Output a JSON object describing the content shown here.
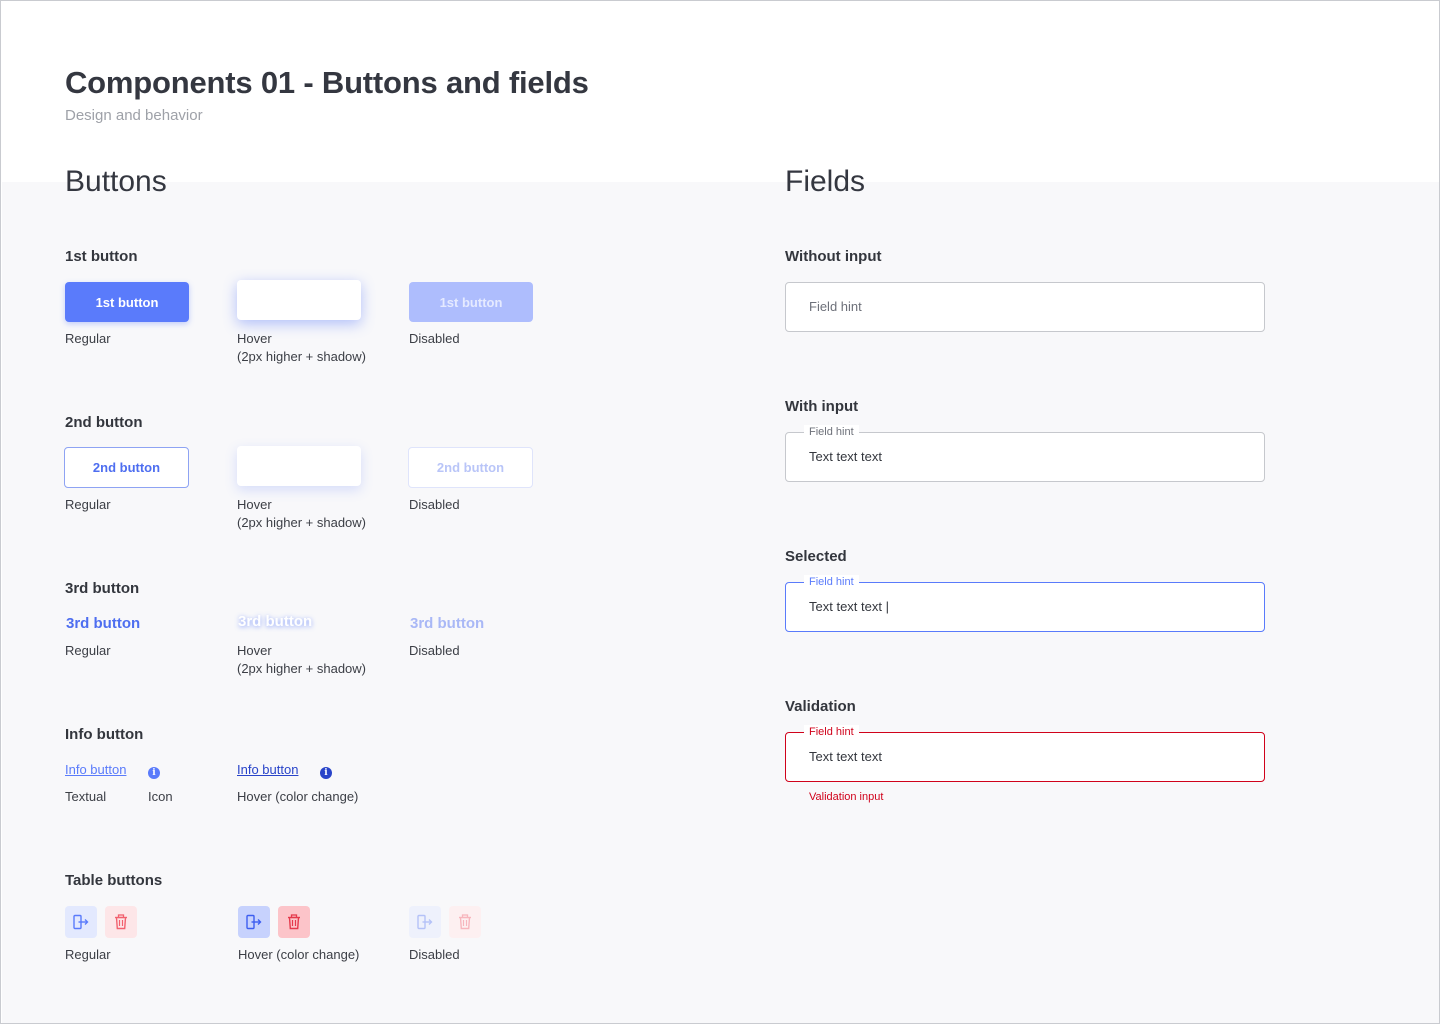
{
  "header": {
    "title": "Components 01 - Buttons and fields",
    "subtitle": "Design and behavior"
  },
  "buttons_section": {
    "title": "Buttons",
    "first": {
      "label": "1st button",
      "regular_text": "1st button",
      "disabled_text": "1st button",
      "caption_regular": "Regular",
      "caption_hover_1": "Hover",
      "caption_hover_2": "(2px higher + shadow)",
      "caption_disabled": "Disabled"
    },
    "second": {
      "label": "2nd button",
      "regular_text": "2nd button",
      "disabled_text": "2nd button",
      "caption_regular": "Regular",
      "caption_hover_1": "Hover",
      "caption_hover_2": "(2px higher + shadow)",
      "caption_disabled": "Disabled"
    },
    "third": {
      "label": "3rd button",
      "regular_text": "3rd button",
      "hover_text": "3rd button",
      "disabled_text": "3rd button",
      "caption_regular": "Regular",
      "caption_hover_1": "Hover",
      "caption_hover_2": "(2px higher + shadow)",
      "caption_disabled": "Disabled"
    },
    "info": {
      "label": "Info button",
      "link_text": "Info button",
      "hover_link_text": "Info button",
      "icon_glyph": "i",
      "caption_textual": "Textual",
      "caption_icon": "Icon",
      "caption_hover": "Hover (color change)"
    },
    "table": {
      "label": "Table buttons",
      "caption_regular": "Regular",
      "caption_hover": "Hover (color change)",
      "caption_disabled": "Disabled",
      "icons": [
        "logout-icon",
        "trash-icon"
      ]
    }
  },
  "fields_section": {
    "title": "Fields",
    "without_input": {
      "label": "Without input",
      "placeholder": "Field hint"
    },
    "with_input": {
      "label": "With input",
      "hint": "Field hint",
      "value": "Text text text"
    },
    "selected": {
      "label": "Selected",
      "hint": "Field hint",
      "value": "Text text text |"
    },
    "validation": {
      "label": "Validation",
      "hint": "Field hint",
      "value": "Text text text",
      "message": "Validation input"
    }
  },
  "colors": {
    "primary": "#5a7bfb",
    "primary_disabled": "#aebdfd",
    "primary_hover_link": "#2944c9",
    "danger": "#d0021b",
    "text": "#33363d",
    "muted": "#9ea1a8",
    "background_band": "#f8f8fa"
  }
}
